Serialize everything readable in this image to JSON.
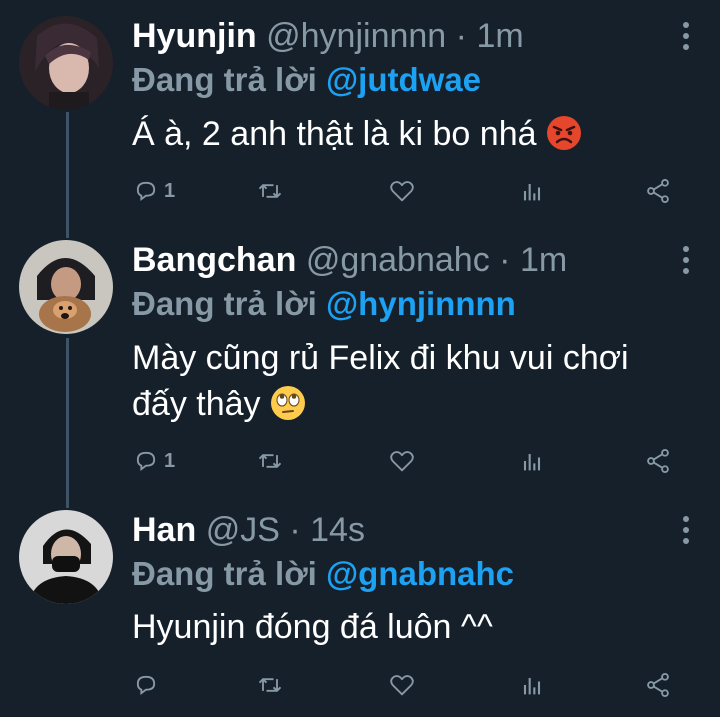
{
  "tweets": [
    {
      "name": "Hyunjin",
      "handle": "@hynjinnnn",
      "dot": "·",
      "time": "1m",
      "replying_label": "Đang trả lời",
      "replying_to": "@jutdwae",
      "text": "Á à, 2 anh thật là ki bo nhá",
      "emoji": "angry-face-emoji",
      "reply_count": "1"
    },
    {
      "name": "Bangchan",
      "handle": "@gnabnahc",
      "dot": "·",
      "time": "1m",
      "replying_label": "Đang trả lời",
      "replying_to": "@hynjinnnn",
      "text_line1": "Mày cũng rủ Felix đi khu vui chơi",
      "text_line2": "đấy thây",
      "emoji": "rolling-eyes-emoji",
      "reply_count": "1"
    },
    {
      "name": "Han",
      "handle": "@JS",
      "dot": "·",
      "time": "14s",
      "replying_label": "Đang trả lời",
      "replying_to": "@gnabnahc",
      "text": "Hyunjin đóng đá luôn ^^",
      "reply_count": ""
    }
  ],
  "icons": {
    "reply": "reply-icon",
    "retweet": "retweet-icon",
    "like": "heart-icon",
    "analytics": "analytics-icon",
    "share": "share-icon",
    "more": "more-vertical-icon"
  },
  "colors": {
    "background": "#15202b",
    "secondary_text": "#8899a6",
    "link": "#1da1f2",
    "thread_line": "#3d5466"
  }
}
